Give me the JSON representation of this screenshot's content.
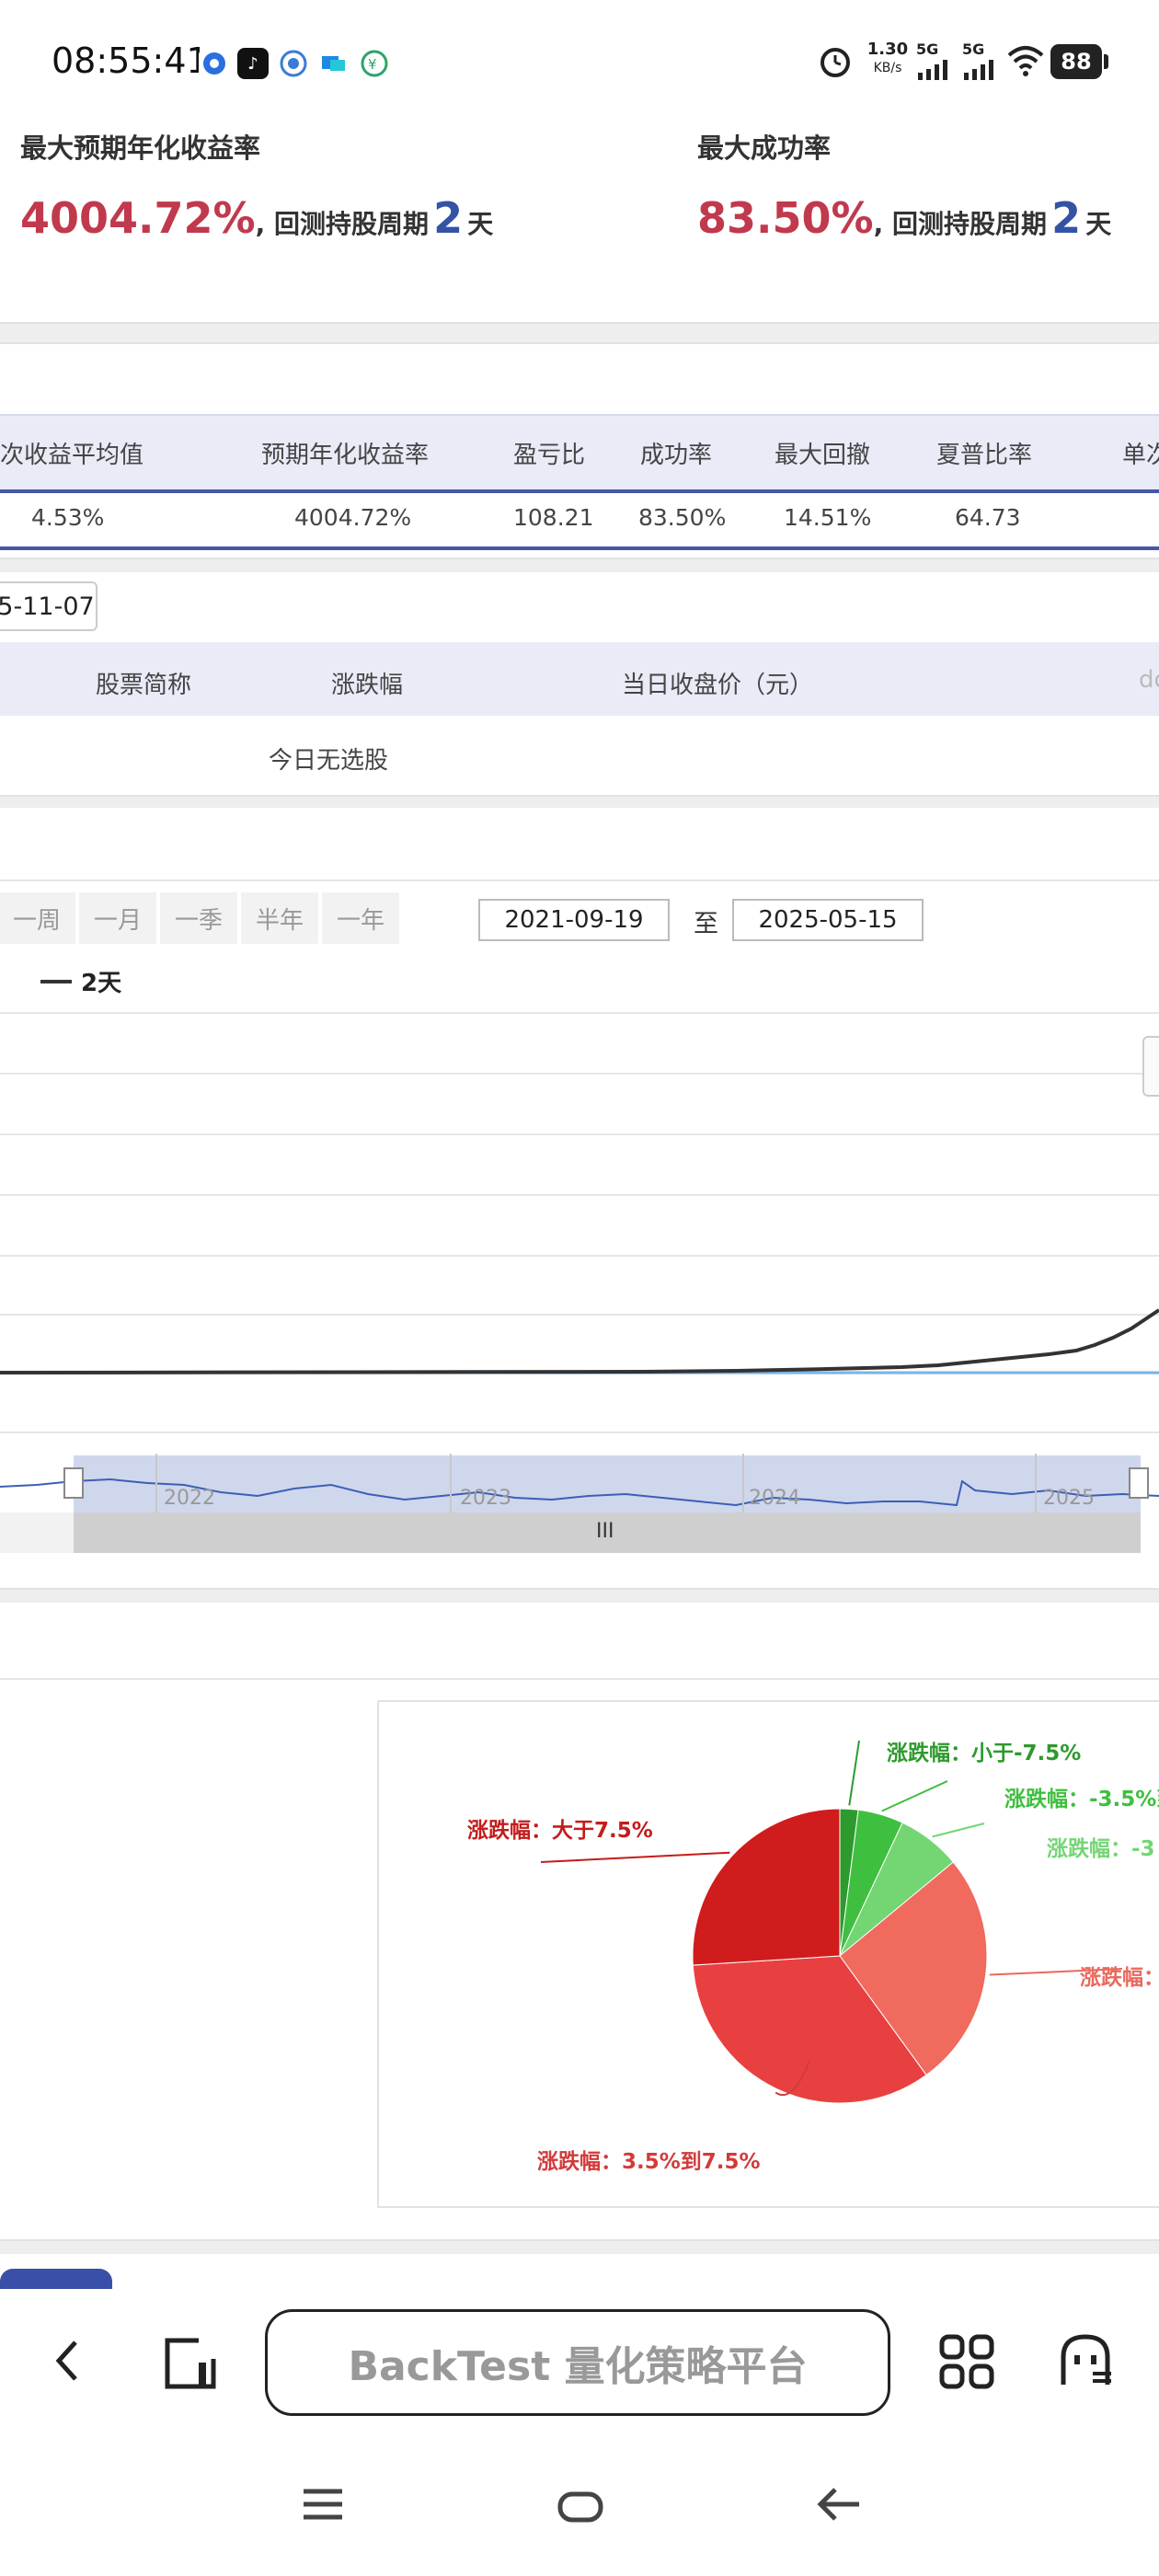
{
  "status_bar": {
    "time": "08:55:41",
    "net_speed_value": "1.30",
    "net_speed_unit": "KB/s",
    "signal_1": "5G",
    "signal_2": "5G",
    "battery": "88"
  },
  "summary": {
    "left": {
      "label": "最大预期年化收益率",
      "value": "4004.72%",
      "mid_text": ", 回测持股周期",
      "days": "2",
      "unit": "天"
    },
    "right": {
      "label": "最大成功率",
      "value": "83.50%",
      "mid_text": ", 回测持股周期",
      "days": "2",
      "unit": "天"
    }
  },
  "stats_table": {
    "headers": [
      "次收益平均值",
      "预期年化收益率",
      "盈亏比",
      "成功率",
      "最大回撤",
      "夏普比率",
      "单次"
    ],
    "row": [
      "4.53%",
      "4004.72%",
      "108.21",
      "83.50%",
      "14.51%",
      "64.73"
    ]
  },
  "stock_table": {
    "date": "5-11-07",
    "headers": [
      "股票简称",
      "涨跌幅",
      "当日收盘价（元）",
      "do"
    ],
    "empty_text": "今日无选股"
  },
  "chart_controls": {
    "ranges": [
      "一周",
      "一月",
      "一季",
      "半年",
      "一年"
    ],
    "start_date": "2021-09-19",
    "to_label": "至",
    "end_date": "2025-05-15",
    "legend": "2天",
    "zoom_handle": "III"
  },
  "chart_data": [
    {
      "type": "line",
      "series": [
        {
          "name": "2天",
          "color": "#333333"
        }
      ],
      "x_ticks": [
        "2022",
        "2023",
        "2024",
        "2025"
      ],
      "trend": "flat near zero from 2021-09 through 2024, rising sharply in 2025"
    },
    {
      "type": "pie",
      "labels": [
        "涨跌幅：小于-7.5%",
        "涨跌幅：-3.5%到",
        "涨跌幅：-3",
        "涨跌幅：",
        "涨跌幅：3.5%到7.5%",
        "涨跌幅：大于7.5%"
      ],
      "values": [
        2,
        5,
        7,
        26,
        34,
        26
      ],
      "colors": [
        "#2d9a2d",
        "#3fbf3f",
        "#73d673",
        "#f06a5e",
        "#e84040",
        "#d01c1c"
      ],
      "label_colors": [
        "#2d9a2d",
        "#3fbf3f",
        "#73d673",
        "#e96a5e",
        "#d43a3a",
        "#c41c1c"
      ]
    }
  ],
  "browser": {
    "title": "BackTest 量化策略平台"
  }
}
